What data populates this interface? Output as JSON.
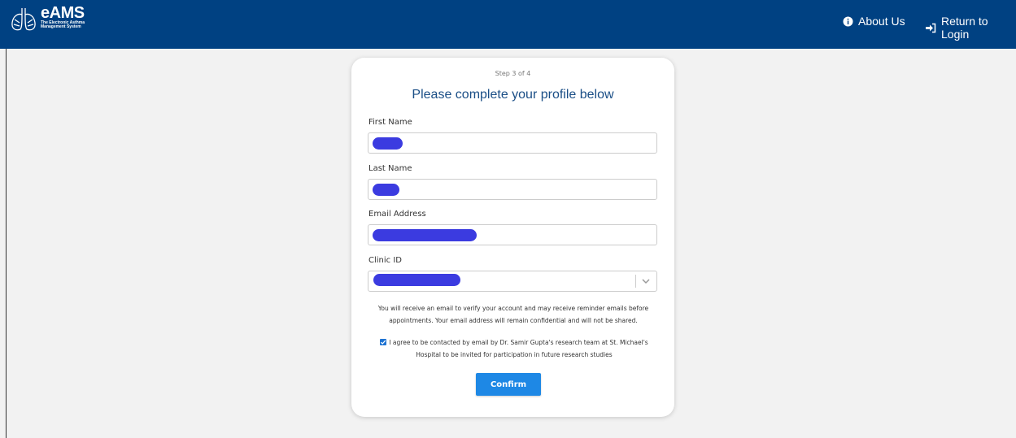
{
  "header": {
    "logo_title": "eAMS",
    "logo_sub_line1": "The Electronic Asthma",
    "logo_sub_line2": "Management System",
    "about_label": "About Us",
    "login_label": "Return to Login",
    "about_icon": "info-circle-icon",
    "login_icon": "sign-in-icon"
  },
  "form": {
    "step": "Step 3 of 4",
    "title": "Please complete your profile below",
    "first_name_label": "First Name",
    "last_name_label": "Last Name",
    "email_label": "Email Address",
    "clinic_label": "Clinic ID",
    "notice": "You will receive an email to verify your account and may receive reminder emails before appointments. Your email address will remain confidential and will not be shared.",
    "consent": "I agree to be contacted by email by Dr. Samir Gupta's research team at St. Michael's Hospital to be invited for participation in future research studies",
    "consent_checked": true,
    "confirm_label": "Confirm"
  },
  "colors": {
    "header_bg": "#004182",
    "title": "#1a4e86",
    "button": "#1e88e5",
    "redaction": "#3b3be0"
  }
}
